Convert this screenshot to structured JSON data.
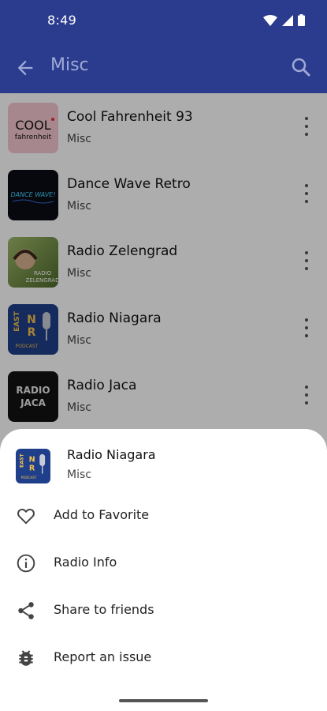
{
  "status_bar": {
    "time": "8:49",
    "icons": [
      "wifi-icon",
      "signal-icon",
      "battery-icon"
    ]
  },
  "app_bar": {
    "title": "Misc",
    "back_icon": "arrow-left-icon",
    "search_icon": "search-icon"
  },
  "stations": [
    {
      "name": "Cool Fahrenheit 93",
      "category": "Misc",
      "logo_text": [
        "COOL",
        "fahrenheit"
      ]
    },
    {
      "name": "Dance Wave Retro",
      "category": "Misc",
      "logo_text": [
        "DANCE WAVE!"
      ]
    },
    {
      "name": "Radio Zelengrad",
      "category": "Misc",
      "logo_text": [
        "RADIO",
        "ZELENGRAD"
      ]
    },
    {
      "name": "Radio Niagara",
      "category": "Misc",
      "logo_text": [
        "EAST",
        "N",
        "R",
        "PODCAST"
      ]
    },
    {
      "name": "Radio Jaca",
      "category": "Misc",
      "logo_text": [
        "RADIO",
        "JACA"
      ]
    }
  ],
  "bottom_sheet": {
    "station": {
      "name": "Radio Niagara",
      "category": "Misc"
    },
    "options": [
      {
        "label": "Add to Favorite",
        "icon": "heart-icon"
      },
      {
        "label": "Radio Info",
        "icon": "info-icon"
      },
      {
        "label": "Share to friends",
        "icon": "share-icon"
      },
      {
        "label": "Report an issue",
        "icon": "bug-icon"
      }
    ]
  },
  "colors": {
    "primary": "#2b3c8f",
    "title_text": "#9ea9d6",
    "scrim": "rgba(0,0,0,0.32)"
  }
}
